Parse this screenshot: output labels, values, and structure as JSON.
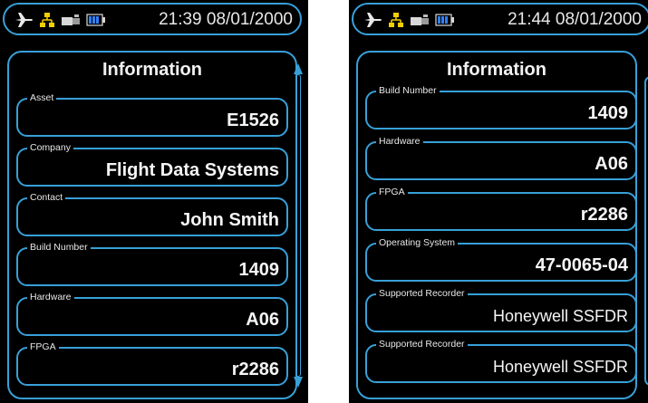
{
  "colors": {
    "accent": "#38a0d8",
    "background": "#000000",
    "text": "#f5f5f5"
  },
  "screens": [
    {
      "status": {
        "icons": [
          "plane-icon",
          "network-icon",
          "usb-icon",
          "battery-icon"
        ],
        "time": "21:39 08/01/2000"
      },
      "title": "Information",
      "fields": [
        {
          "label": "Asset",
          "value": "E1526"
        },
        {
          "label": "Company",
          "value": "Flight Data Systems"
        },
        {
          "label": "Contact",
          "value": "John Smith"
        },
        {
          "label": "Build Number",
          "value": "1409"
        },
        {
          "label": "Hardware",
          "value": "A06"
        },
        {
          "label": "FPGA",
          "value": "r2286"
        }
      ]
    },
    {
      "status": {
        "icons": [
          "plane-icon",
          "network-icon",
          "usb-icon",
          "battery-icon"
        ],
        "time": "21:44 08/01/2000"
      },
      "title": "Information",
      "fields": [
        {
          "label": "Build Number",
          "value": "1409"
        },
        {
          "label": "Hardware",
          "value": "A06"
        },
        {
          "label": "FPGA",
          "value": "r2286"
        },
        {
          "label": "Operating System",
          "value": "47-0065-04"
        },
        {
          "label": "Supported Recorder",
          "value": "Honeywell SSFDR"
        },
        {
          "label": "Supported Recorder",
          "value": "Honeywell SSFDR"
        }
      ]
    }
  ]
}
